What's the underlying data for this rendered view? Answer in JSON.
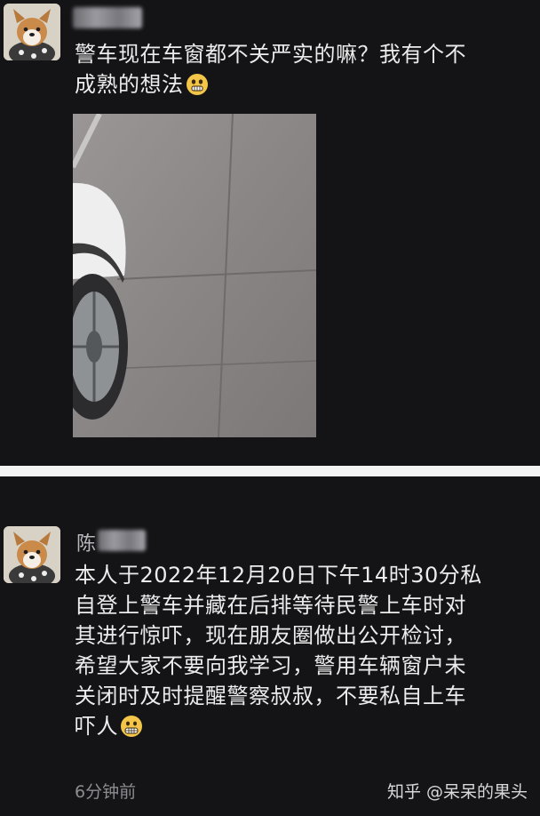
{
  "post_top": {
    "username": "",
    "message_line1": "警车现在车窗都不关严实的嘛？我有个不",
    "message_line2": "成熟的想法",
    "emoji": "nervous-face-emoji"
  },
  "post_bottom": {
    "username_visible_char": "陈",
    "message_lines": [
      "本人于2022年12月20日下午14时30分私",
      "自登上警车并藏在后排等待民警上车时对",
      "其进行惊吓，现在朋友圈做出公开检讨，",
      "希望大家不要向我学习，警用车辆窗户未",
      "关闭时及时提醒警察叔叔，不要私自上车",
      "吓人"
    ],
    "emoji": "grimacing-face-emoji",
    "timestamp": "6分钟前"
  },
  "watermark": "知乎 @呆呆的果头",
  "colors": {
    "background": "#141416",
    "divider": "#f4f4f4",
    "text": "#ececec",
    "muted": "#8c8c92"
  }
}
